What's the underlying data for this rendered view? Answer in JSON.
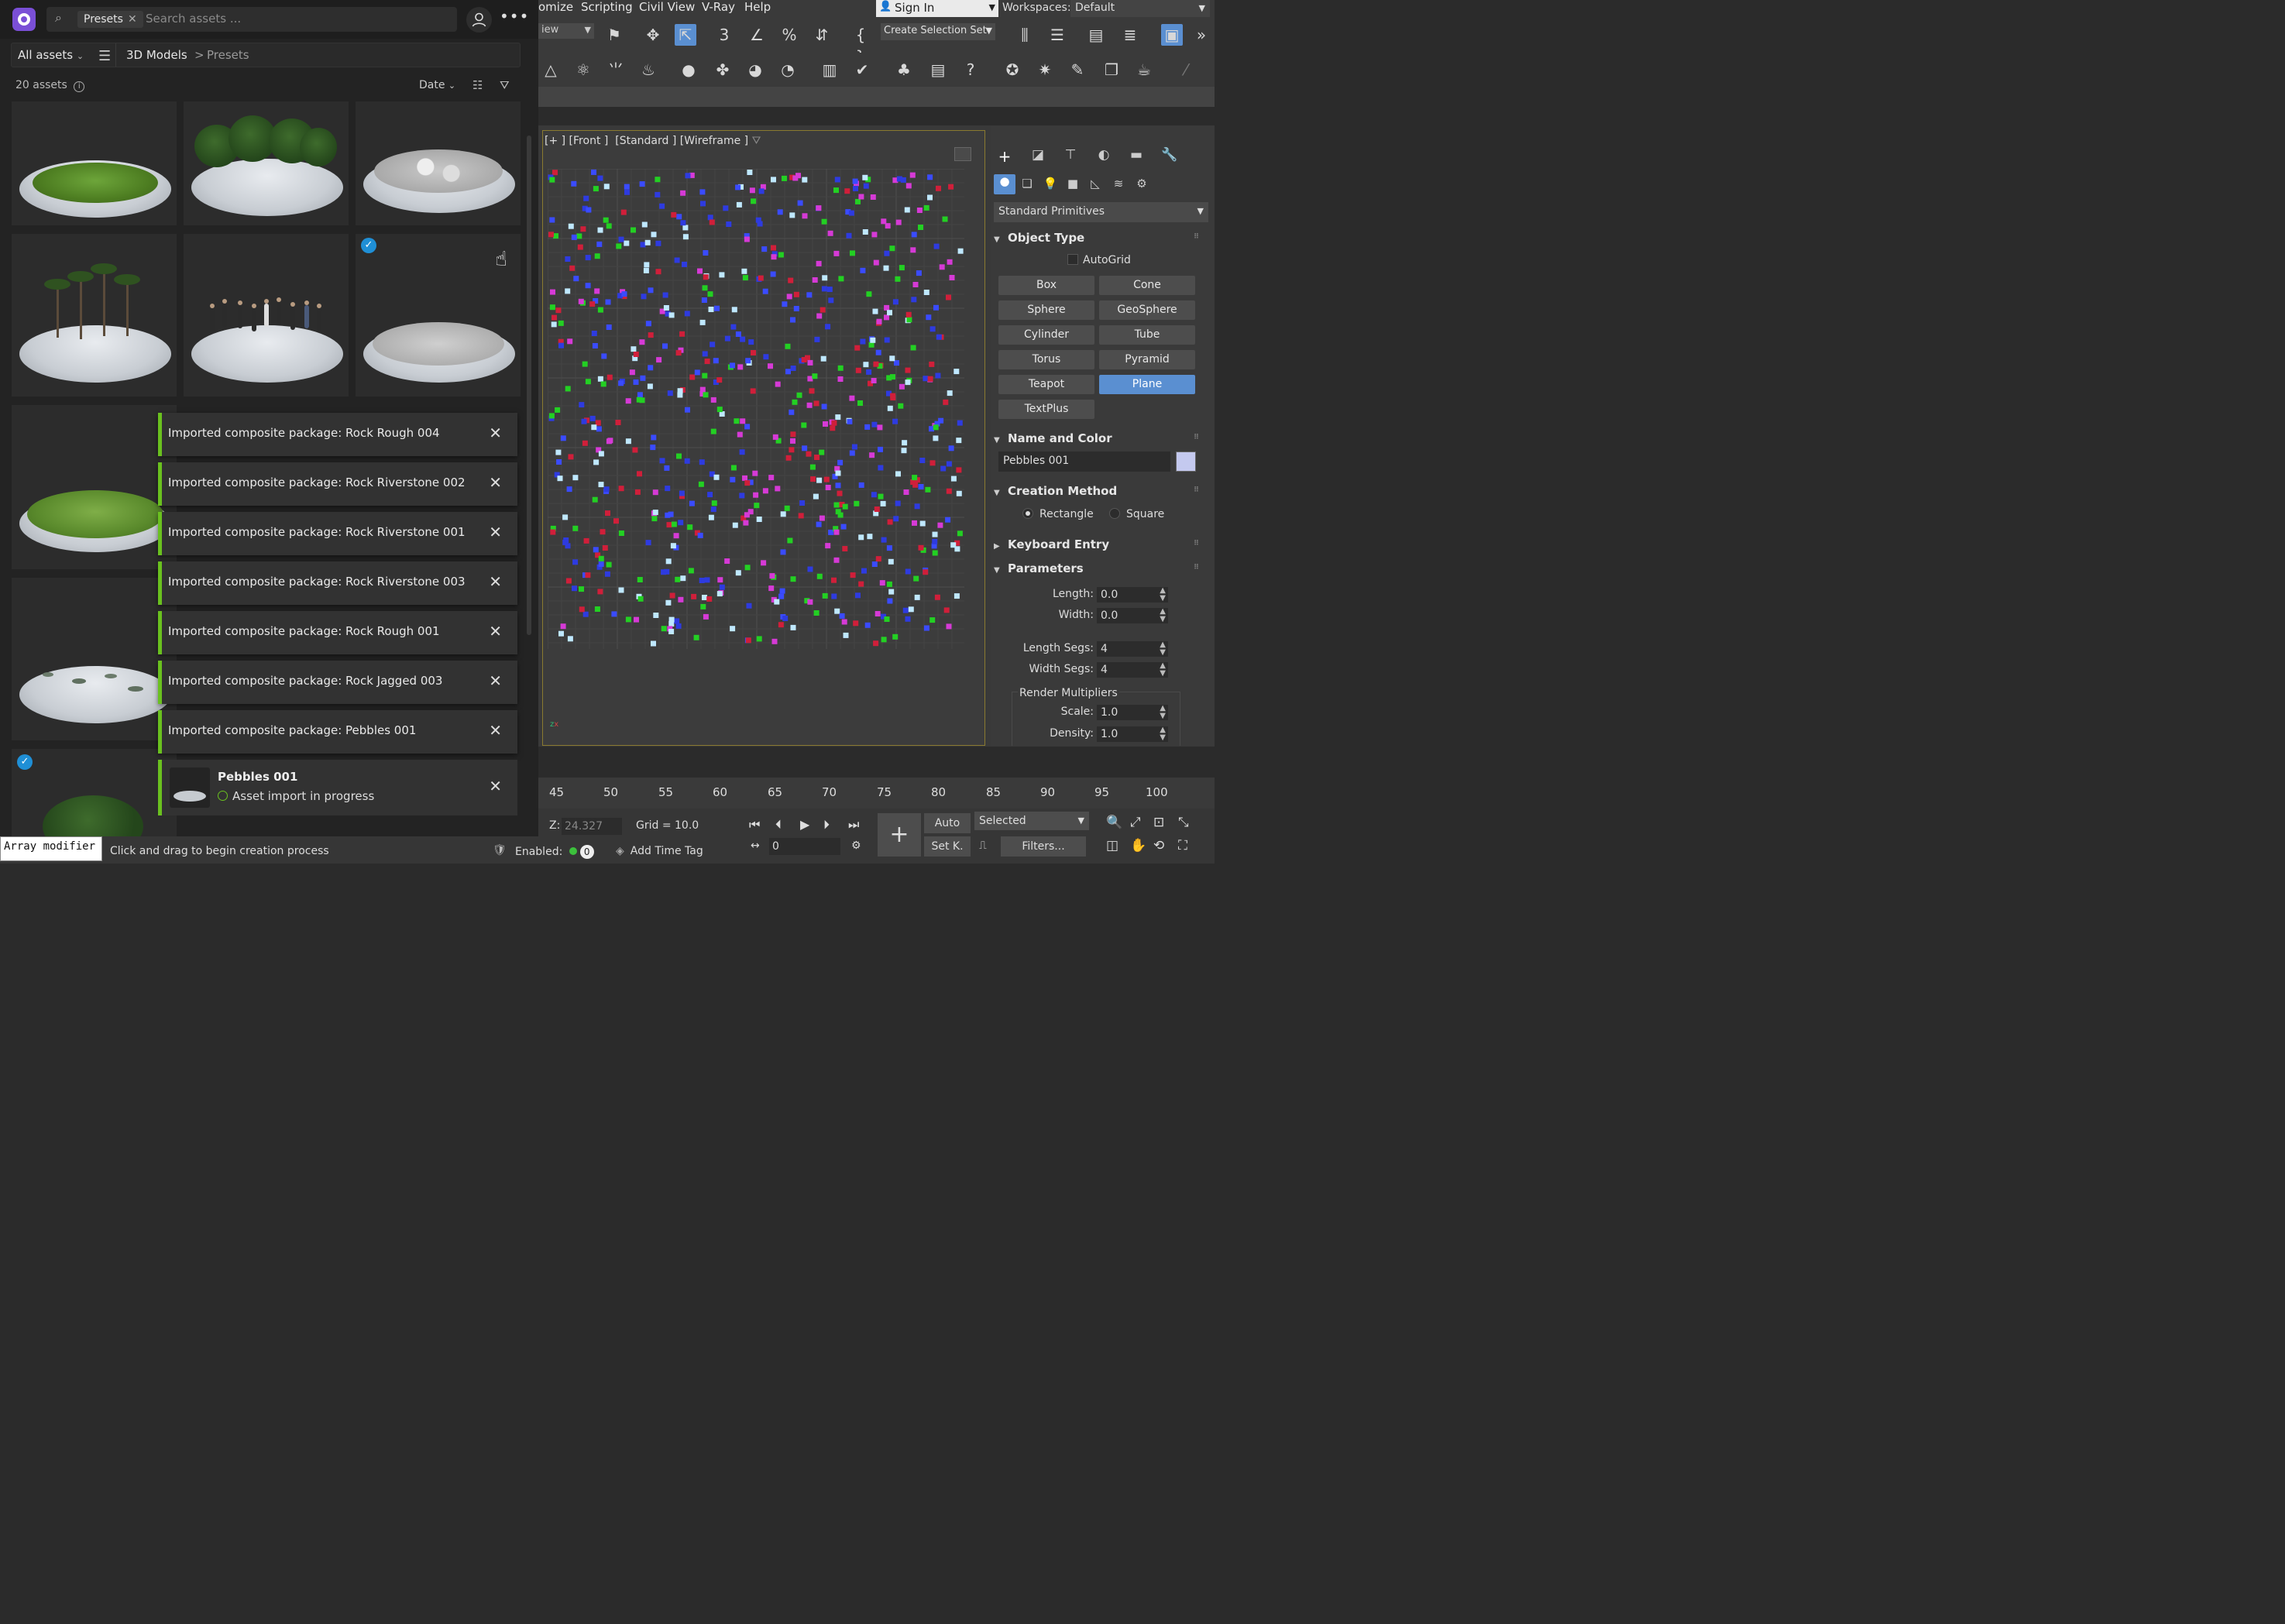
{
  "library": {
    "search": {
      "chip": "Presets",
      "placeholder": "Search assets ..."
    },
    "crumbs": {
      "scope": "All assets",
      "path1": "3D Models",
      "path2": "Presets",
      "sep": ">"
    },
    "count": "20 assets",
    "sort": "Date",
    "toasts": [
      {
        "text": "Imported composite package: Rock Rough 004"
      },
      {
        "text": "Imported composite package: Rock Riverstone 002"
      },
      {
        "text": "Imported composite package: Rock Riverstone 001"
      },
      {
        "text": "Imported composite package: Rock Riverstone 003"
      },
      {
        "text": "Imported composite package: Rock Rough 001"
      },
      {
        "text": "Imported composite package: Rock Jagged 003"
      },
      {
        "text": "Imported composite package: Pebbles 001"
      }
    ],
    "progress": {
      "title": "Pebbles 001",
      "status": "Asset import in progress"
    }
  },
  "menubar": {
    "items": [
      "omize",
      "Scripting",
      "Civil View",
      "V-Ray",
      "Help"
    ],
    "signin": "Sign In",
    "workspaces_label": "Workspaces:",
    "workspaces_value": "Default"
  },
  "toolbar": {
    "view_dropdown": "iew",
    "selection_set": "Create Selection Set"
  },
  "viewport": {
    "label": "[+ ] [Front ]  [Standard ] [Wireframe ]"
  },
  "command_panel": {
    "category": "Standard Primitives",
    "object_type": {
      "title": "Object Type",
      "autogrid": "AutoGrid",
      "buttons": [
        "Box",
        "Cone",
        "Sphere",
        "GeoSphere",
        "Cylinder",
        "Tube",
        "Torus",
        "Pyramid",
        "Teapot",
        "Plane",
        "TextPlus"
      ],
      "selected": "Plane"
    },
    "name_color": {
      "title": "Name and Color",
      "name": "Pebbles 001",
      "color": "#c4c9ef"
    },
    "creation_method": {
      "title": "Creation Method",
      "opt1": "Rectangle",
      "opt2": "Square"
    },
    "keyboard_entry": {
      "title": "Keyboard Entry"
    },
    "parameters": {
      "title": "Parameters",
      "length_label": "Length:",
      "length": "0.0",
      "width_label": "Width:",
      "width": "0.0",
      "lsegs_label": "Length Segs:",
      "lsegs": "4",
      "wsegs_label": "Width Segs:",
      "wsegs": "4",
      "rm_title": "Render Multipliers",
      "scale_label": "Scale:",
      "scale": "1.0",
      "density_label": "Density:",
      "density": "1.0"
    }
  },
  "timeline": {
    "ticks": [
      "45",
      "50",
      "55",
      "60",
      "65",
      "70",
      "75",
      "80",
      "85",
      "90",
      "95",
      "100"
    ]
  },
  "bottom": {
    "z_label": "Z:",
    "z_value": "24.327",
    "grid": "Grid = 10.0",
    "frame": "0",
    "auto": "Auto",
    "setk": "Set K.",
    "selected": "Selected",
    "filters": "Filters...",
    "enabled": "Enabled:",
    "enabled_count": "0",
    "timetag": "Add Time Tag"
  },
  "status": {
    "mod": "Array modifier",
    "hint": "Click and drag to begin creation process"
  },
  "colors": {
    "accent": "#5a8fd1",
    "success": "#6ac11f",
    "brand": "#7a4fd6"
  }
}
